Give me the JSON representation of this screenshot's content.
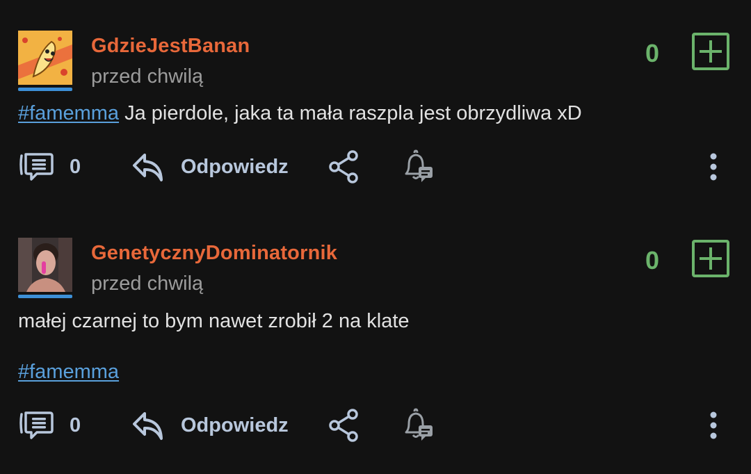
{
  "posts": [
    {
      "author": "GdzieJestBanan",
      "time": "przed chwilą",
      "score": "0",
      "tag": "#famemma",
      "text": " Ja pierdole, jaka ta mała raszpla jest obrzydliwa xD",
      "comments_count": "0",
      "reply_label": "Odpowiedz"
    },
    {
      "author": "GenetycznyDominatornik",
      "time": "przed chwilą",
      "score": "0",
      "text": "małej czarnej to bym nawet zrobił 2 na klate",
      "tag": "#famemma",
      "comments_count": "0",
      "reply_label": "Odpowiedz"
    }
  ],
  "colors": {
    "background": "#121212",
    "username": "#e8683a",
    "score": "#6bb36b",
    "link": "#5aa0dc",
    "action": "#b8c7dc",
    "avatar_bar": "#3d8fd6"
  },
  "icons": {
    "comments": "comments-icon",
    "reply": "reply-icon",
    "share": "share-icon",
    "notify": "notification-bell-icon",
    "more": "more-vertical-icon",
    "plus": "plus-icon"
  }
}
